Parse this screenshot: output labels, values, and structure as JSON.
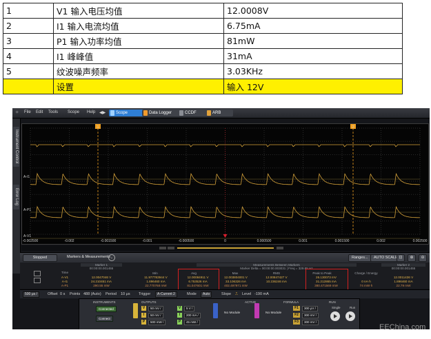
{
  "table": {
    "rows": [
      {
        "n": "1",
        "item": "V1 输入电压均值",
        "value": "12.0008V"
      },
      {
        "n": "2",
        "item": "I1 输入电流均值",
        "value": "6.75mA"
      },
      {
        "n": "3",
        "item": "P1 输入功率均值",
        "value": "81mW"
      },
      {
        "n": "4",
        "item": "I1 峰峰值",
        "value": "31mA"
      },
      {
        "n": "5",
        "item": "纹波噪声频率",
        "value": "3.03KHz"
      }
    ],
    "footer": {
      "n": "",
      "item": "设置",
      "value": "输入 12V"
    }
  },
  "menu": {
    "items": [
      "File",
      "Edit",
      "Tools",
      "Scope",
      "Help"
    ],
    "tabs": [
      {
        "label": "Scope",
        "color": "#2f7fd6"
      },
      {
        "label": "Data Logger",
        "color": "#4b4e56"
      },
      {
        "label": "CCDF",
        "color": "#4b4e56"
      },
      {
        "label": "ARB",
        "color": "#4b4e56"
      }
    ]
  },
  "side_tabs": [
    "Instrument Control",
    "Error Log"
  ],
  "traces": {
    "labels": [
      "A-I1",
      "A-P1",
      "A-V1"
    ],
    "colors": {
      "trace": "#d7a33a",
      "marker": "#f0a020",
      "trigger": "#d81f2c"
    }
  },
  "markers": {
    "m1": "1",
    "m2": "2"
  },
  "time_axis": [
    "-0.002500",
    "-0.002",
    "-0.001500",
    "-0.001",
    "-0.000500",
    "0",
    "0.000500",
    "0.001",
    "0.001500",
    "0.002",
    "0.002500"
  ],
  "measurements": {
    "header": {
      "stopped": "Stopped",
      "title": "Markers & Measurements",
      "ranges": "Ranges...",
      "autoscale": "AUTO SCALE"
    },
    "marker1_title": "Marker 1",
    "marker1_time": "00:00:00.001455",
    "marker2_title": "Marker 2",
    "marker2_time": "00:00:00.001455",
    "between_title": "Measurements Between Markers",
    "between_sub": "Marker Delta = 00:00:00.003031 | Freq = 329.85 Hz",
    "columns": [
      "Time",
      "Min",
      "Avg",
      "Max",
      "RMS",
      "Peak to Peak",
      "Charge / Energy"
    ],
    "rows": [
      {
        "ch": "A-V1",
        "m1": "12.0047046 V",
        "min": "11.977783944 V",
        "avg": "12.00084911 V",
        "max": "12.003804001 V",
        "rms": "12.00847427 V",
        "pp": "26.130073 mV",
        "ce": "",
        "m2": "12.0011436 V"
      },
      {
        "ch": "A-I1",
        "m1": "24.210451 mA",
        "min": "1.896460 mA",
        "avg": "6.753526 mA",
        "max": "33.106326 mA",
        "rms": "10.236246 mA",
        "pp": "31.212865 mA",
        "ce": "0 nA·h",
        "m2": "1.896460 mA"
      },
      {
        "ch": "A-P1",
        "m1": "290.55 mW",
        "min": "22.770768 mW",
        "avg": "81.047601 mW",
        "max": "402.497971 mW",
        "rms": "",
        "pp": "380.471569 mW",
        "ce": "74 mW·h",
        "m2": "22.79 mW"
      }
    ]
  },
  "trigger_bar": {
    "timebase": "500 μs /",
    "offset_label": "Offset",
    "offset": "0 s",
    "points_label": "Points",
    "points": "488 (Auto)",
    "period_label": "Period",
    "period": "10 μs",
    "trigger_label": "Trigger",
    "trigger": "A-Current 2",
    "mode_label": "Mode",
    "mode": "Auto",
    "slope_label": "Slope",
    "level_label": "Level",
    "level": "-190 mA"
  },
  "bottom": {
    "instruments": "INSTRUMENTS",
    "outputs": "OUTPUTS",
    "active": "ACTIVE",
    "formula": "FORMULA",
    "run": "RUN",
    "connected": "Connected",
    "connect": "Connect",
    "ch_a": [
      "50 mV /",
      "50 mV /",
      "500 mW /"
    ],
    "ch_b": [
      "5 V /",
      "200 mA /",
      "45 mW /"
    ],
    "no_module_1": "No Module",
    "no_module_2": "No Module",
    "f": [
      {
        "label": "F1",
        "val": "300 μV /"
      },
      {
        "label": "F2",
        "val": "300 mV /"
      },
      {
        "label": "F3",
        "val": "300 mV /"
      }
    ],
    "single": "Single",
    "run_label": "Run"
  },
  "watermark": "EEChina.com"
}
